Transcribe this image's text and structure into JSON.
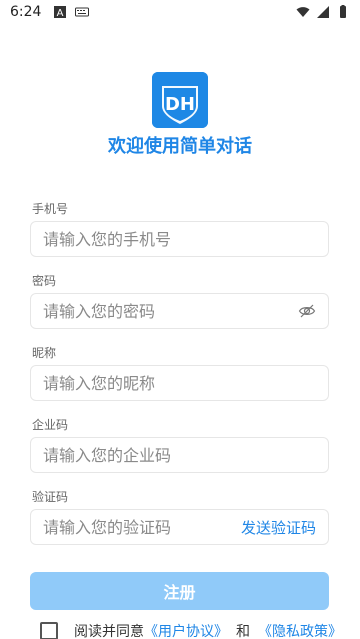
{
  "status_bar": {
    "time": "6:24",
    "left_icons": [
      "a-icon",
      "keyboard-icon"
    ],
    "right_icons": [
      "wifi-icon",
      "signal-icon",
      "battery-icon"
    ]
  },
  "header": {
    "logo_alt": "DH",
    "welcome_text": "欢迎使用简单对话"
  },
  "form": {
    "phone": {
      "label": "手机号",
      "placeholder": "请输入您的手机号"
    },
    "password": {
      "label": "密码",
      "placeholder": "请输入您的密码",
      "toggle_icon": "eye-off-icon"
    },
    "nickname": {
      "label": "昵称",
      "placeholder": "请输入您的昵称"
    },
    "company_code": {
      "label": "企业码",
      "placeholder": "请输入您的企业码"
    },
    "verify_code": {
      "label": "验证码",
      "placeholder": "请输入您的验证码",
      "send_label": "发送验证码"
    }
  },
  "register_button": {
    "label": "注册"
  },
  "agreement": {
    "prefix": "阅读并同意",
    "user_agreement": "《用户协议》",
    "and": "和",
    "privacy_policy": "《隐私政策》"
  },
  "colors": {
    "primary": "#1f86e6",
    "button_disabled": "#90caf9",
    "logo_bg": "#1e88e5"
  }
}
